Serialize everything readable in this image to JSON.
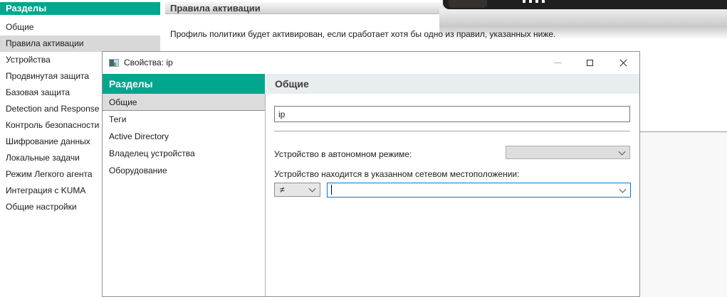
{
  "background_window": {
    "sidebar": {
      "header": "Разделы",
      "items": [
        {
          "label": "Общие",
          "selected": false
        },
        {
          "label": "Правила активации",
          "selected": true
        },
        {
          "label": "Устройства",
          "selected": false
        },
        {
          "label": "Продвинутая защита",
          "selected": false
        },
        {
          "label": "Базовая защита",
          "selected": false
        },
        {
          "label": "Detection and Response",
          "selected": false
        },
        {
          "label": "Контроль безопасности",
          "selected": false
        },
        {
          "label": "Шифрование данных",
          "selected": false
        },
        {
          "label": "Локальные задачи",
          "selected": false
        },
        {
          "label": "Режим Легкого агента",
          "selected": false
        },
        {
          "label": "Интеграция с KUMA",
          "selected": false
        },
        {
          "label": "Общие настройки",
          "selected": false
        }
      ]
    },
    "main": {
      "header": "Правила активации",
      "description": "Профиль политики будет активирован, если сработает хотя бы одно из правил, указанных ниже."
    }
  },
  "toolbar_overlay": {
    "grip_icon": "grip-dots-icon"
  },
  "dialog": {
    "title": "Свойства: ip",
    "window_controls": {
      "minimize": "minimize-icon",
      "maximize": "maximize-icon",
      "close": "close-icon"
    },
    "sidebar": {
      "header": "Разделы",
      "items": [
        {
          "label": "Общие",
          "selected": true
        },
        {
          "label": "Теги",
          "selected": false
        },
        {
          "label": "Active Directory",
          "selected": false
        },
        {
          "label": "Владелец устройства",
          "selected": false
        },
        {
          "label": "Оборудование",
          "selected": false
        }
      ]
    },
    "content": {
      "header": "Общие",
      "name_value": "ip",
      "offline_mode": {
        "label": "Устройство в автономном режиме:",
        "value": ""
      },
      "network_location": {
        "label": "Устройство находится в указанном сетевом местоположении:",
        "operator": "≠",
        "value": ""
      }
    }
  },
  "colors": {
    "teal_header": "#00a78d",
    "selected_item_bg": "#d8d8d8",
    "dialog_section_header_bg": "#e8edef",
    "focus_border": "#0078d7",
    "dark_toolbar": "#1f1f1f"
  }
}
